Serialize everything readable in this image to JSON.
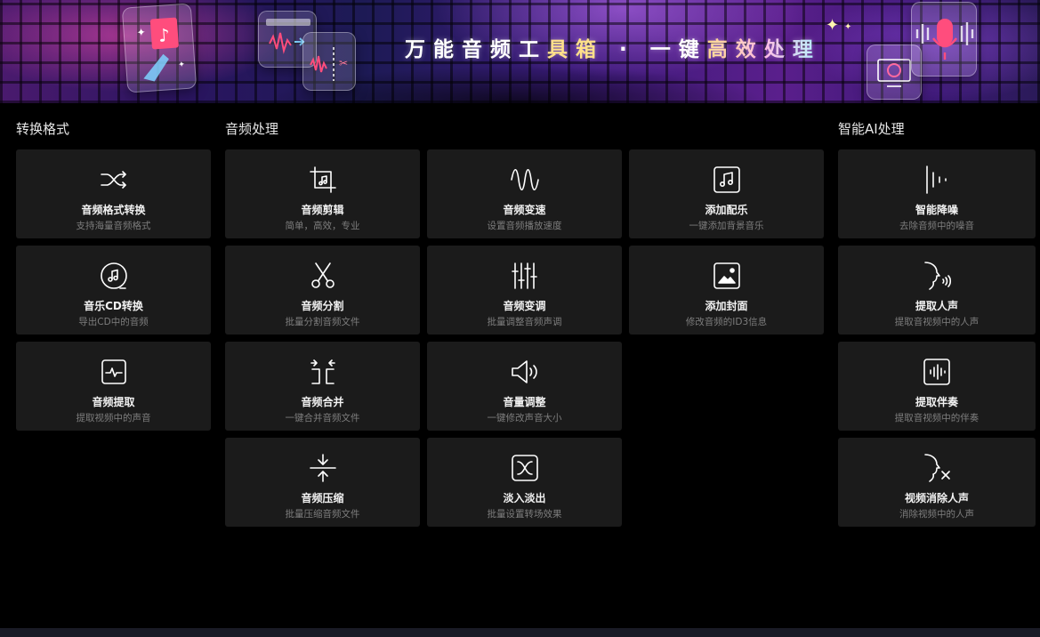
{
  "banner": {
    "title_part1": "万能音频工",
    "title_part2": "具箱",
    "title_part3": " · 一键",
    "title_part4": "高效处理"
  },
  "sections": {
    "convert": "转换格式",
    "audio": "音频处理",
    "ai": "智能AI处理"
  },
  "cards": {
    "format_convert": {
      "name": "音频格式转换",
      "desc": "支持海量音频格式",
      "icon": "shuffle-icon"
    },
    "cd_convert": {
      "name": "音乐CD转换",
      "desc": "导出CD中的音频",
      "icon": "music-disc-icon"
    },
    "audio_extract": {
      "name": "音频提取",
      "desc": "提取视频中的声音",
      "icon": "waveform-box-icon"
    },
    "audio_cut": {
      "name": "音频剪辑",
      "desc": "简单，高效，专业",
      "icon": "crop-note-icon"
    },
    "audio_split": {
      "name": "音频分割",
      "desc": "批量分割音频文件",
      "icon": "scissors-icon"
    },
    "audio_merge": {
      "name": "音频合并",
      "desc": "一键合并音频文件",
      "icon": "merge-icon"
    },
    "audio_compress": {
      "name": "音频压缩",
      "desc": "批量压缩音频文件",
      "icon": "compress-icon"
    },
    "audio_speed": {
      "name": "音频变速",
      "desc": "设置音频播放速度",
      "icon": "sine-wave-icon"
    },
    "audio_pitch": {
      "name": "音频变调",
      "desc": "批量调整音频声调",
      "icon": "sliders-icon"
    },
    "volume": {
      "name": "音量调整",
      "desc": "一键修改声音大小",
      "icon": "speaker-icon"
    },
    "fade": {
      "name": "淡入淡出",
      "desc": "批量设置转场效果",
      "icon": "crossfade-icon"
    },
    "add_music": {
      "name": "添加配乐",
      "desc": "一键添加背景音乐",
      "icon": "music-note-box-icon"
    },
    "add_cover": {
      "name": "添加封面",
      "desc": "修改音频的ID3信息",
      "icon": "image-icon"
    },
    "denoise": {
      "name": "智能降噪",
      "desc": "去除音频中的噪音",
      "icon": "denoise-bars-icon"
    },
    "extract_voice": {
      "name": "提取人声",
      "desc": "提取音视频中的人声",
      "icon": "voice-face-icon"
    },
    "extract_accomp": {
      "name": "提取伴奏",
      "desc": "提取音视频中的伴奏",
      "icon": "audio-bars-box-icon"
    },
    "remove_voice": {
      "name": "视频消除人声",
      "desc": "消除视频中的人声",
      "icon": "mute-face-icon"
    }
  }
}
